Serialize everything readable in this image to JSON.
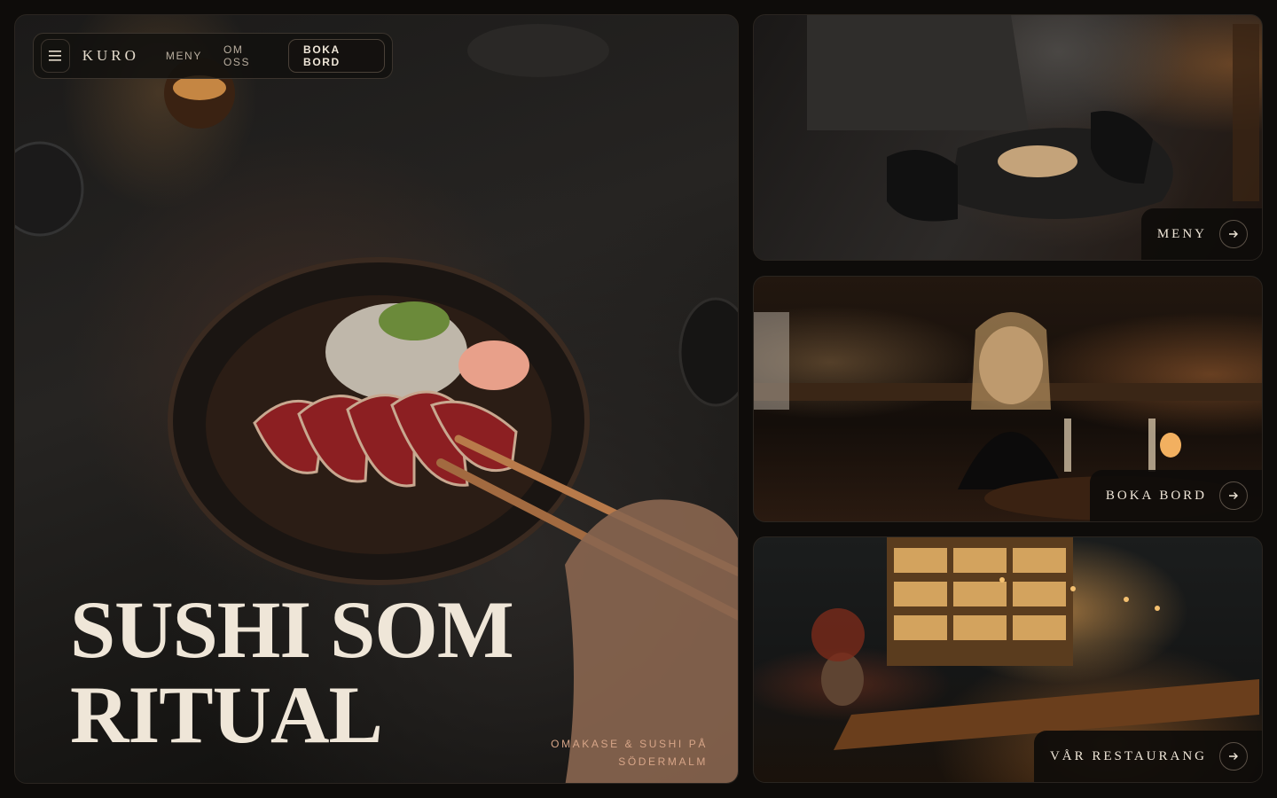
{
  "nav": {
    "logo": "KURO",
    "links": [
      "MENY",
      "OM OSS"
    ],
    "cta": "BOKA BORD",
    "menu_icon": "hamburger-icon"
  },
  "hero": {
    "title_line1": "SUSHI SOM",
    "title_line2": "RITUAL",
    "tagline_line1": "OMAKASE & SUSHI PÅ",
    "tagline_line2": "SÖDERMALM"
  },
  "cards": [
    {
      "label": "MENY",
      "icon": "arrow-right-icon"
    },
    {
      "label": "BOKA BORD",
      "icon": "arrow-right-icon"
    },
    {
      "label": "VÅR RESTAURANG",
      "icon": "arrow-right-icon"
    }
  ],
  "colors": {
    "background": "#0e0c0a",
    "text": "#efe6d8",
    "accent": "#d7a588",
    "border": "#3b342d"
  }
}
